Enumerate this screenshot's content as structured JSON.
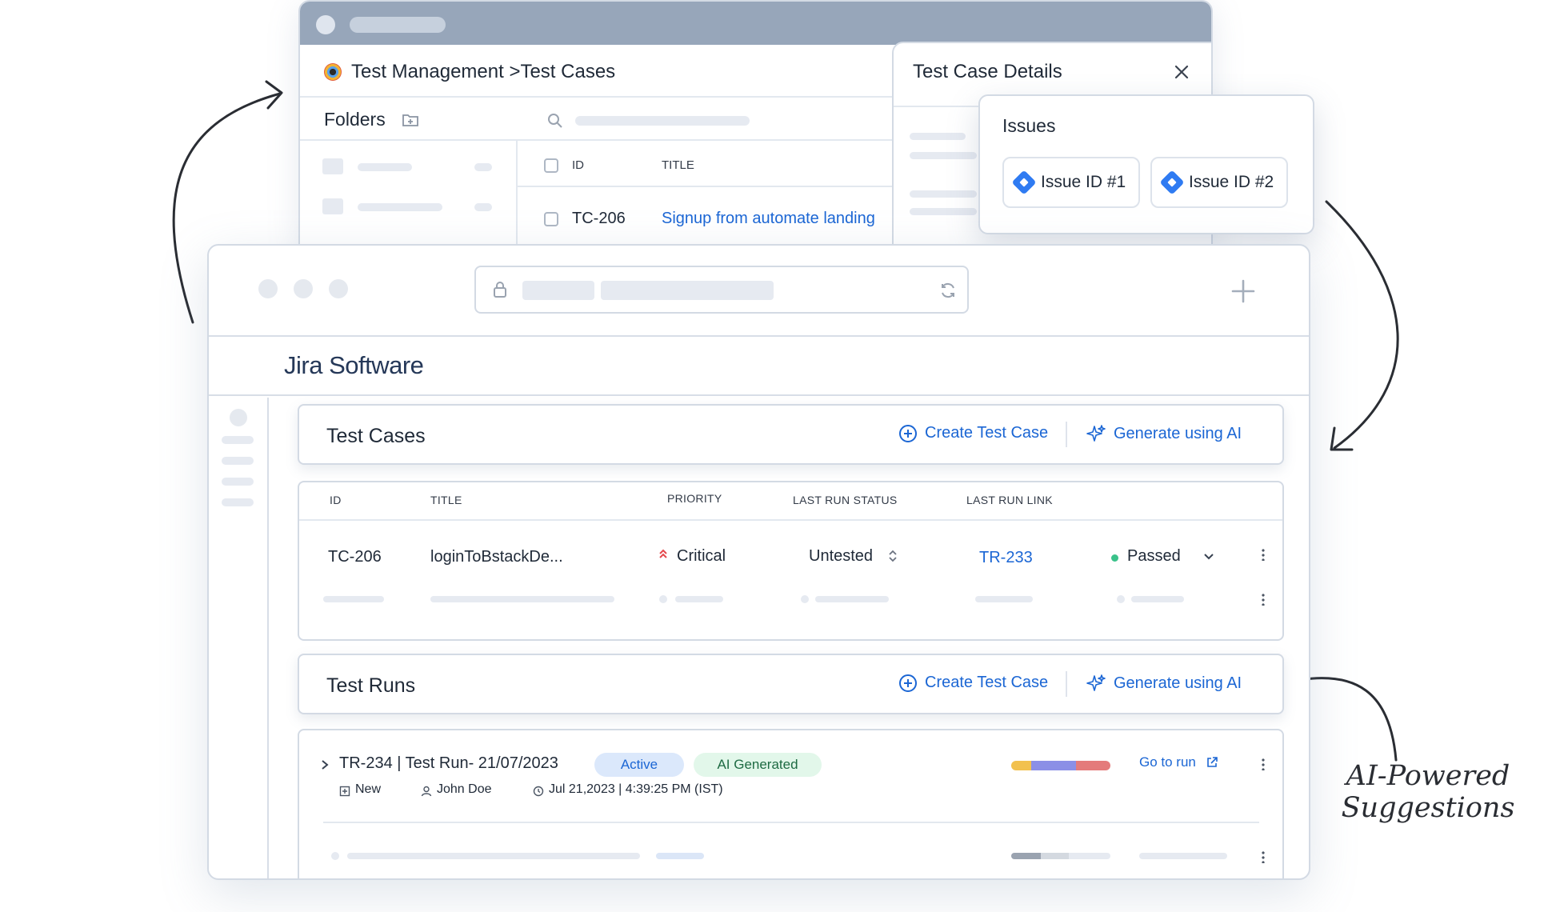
{
  "back_window": {
    "breadcrumb": "Test Management >Test Cases",
    "folders_label": "Folders",
    "columns": {
      "id": "ID",
      "title": "TITLE"
    },
    "row": {
      "id": "TC-206",
      "title": "Signup from automate landing"
    }
  },
  "details_panel": {
    "title": "Test Case Details",
    "issues": {
      "title": "Issues",
      "items": [
        "Issue ID #1",
        "Issue ID #2"
      ]
    }
  },
  "jira": {
    "brand": "Jira Software",
    "colors": {
      "accent": "#1b66d4",
      "diamond": "#2f7bf2",
      "critical": "#e5484d",
      "passed": "#3ac28a"
    }
  },
  "test_cases": {
    "title": "Test Cases",
    "create_label": "Create Test Case",
    "generate_label": "Generate using AI",
    "columns": {
      "id": "ID",
      "title": "TITLE",
      "priority": "PRIORITY",
      "last_run_status": "LAST RUN STATUS",
      "last_run_link": "LAST RUN LINK"
    },
    "row": {
      "id": "TC-206",
      "title": "loginToBstackDe...",
      "priority": "Critical",
      "last_run_status": "Untested",
      "last_run_link": "TR-233",
      "result": "Passed"
    }
  },
  "test_runs": {
    "title": "Test Runs",
    "create_label": "Create Test Case",
    "generate_label": "Generate using AI",
    "run": {
      "name": "TR-234 | Test Run- 21/07/2023",
      "status_badge": "Active",
      "ai_badge": "AI Generated",
      "state": "New",
      "assignee": "John Doe",
      "datetime": "Jul 21,2023 | 4:39:25 PM (IST)",
      "go_to_run": "Go to run"
    }
  },
  "annotation": {
    "line1": "AI-Powered",
    "line2": "Suggestions"
  }
}
